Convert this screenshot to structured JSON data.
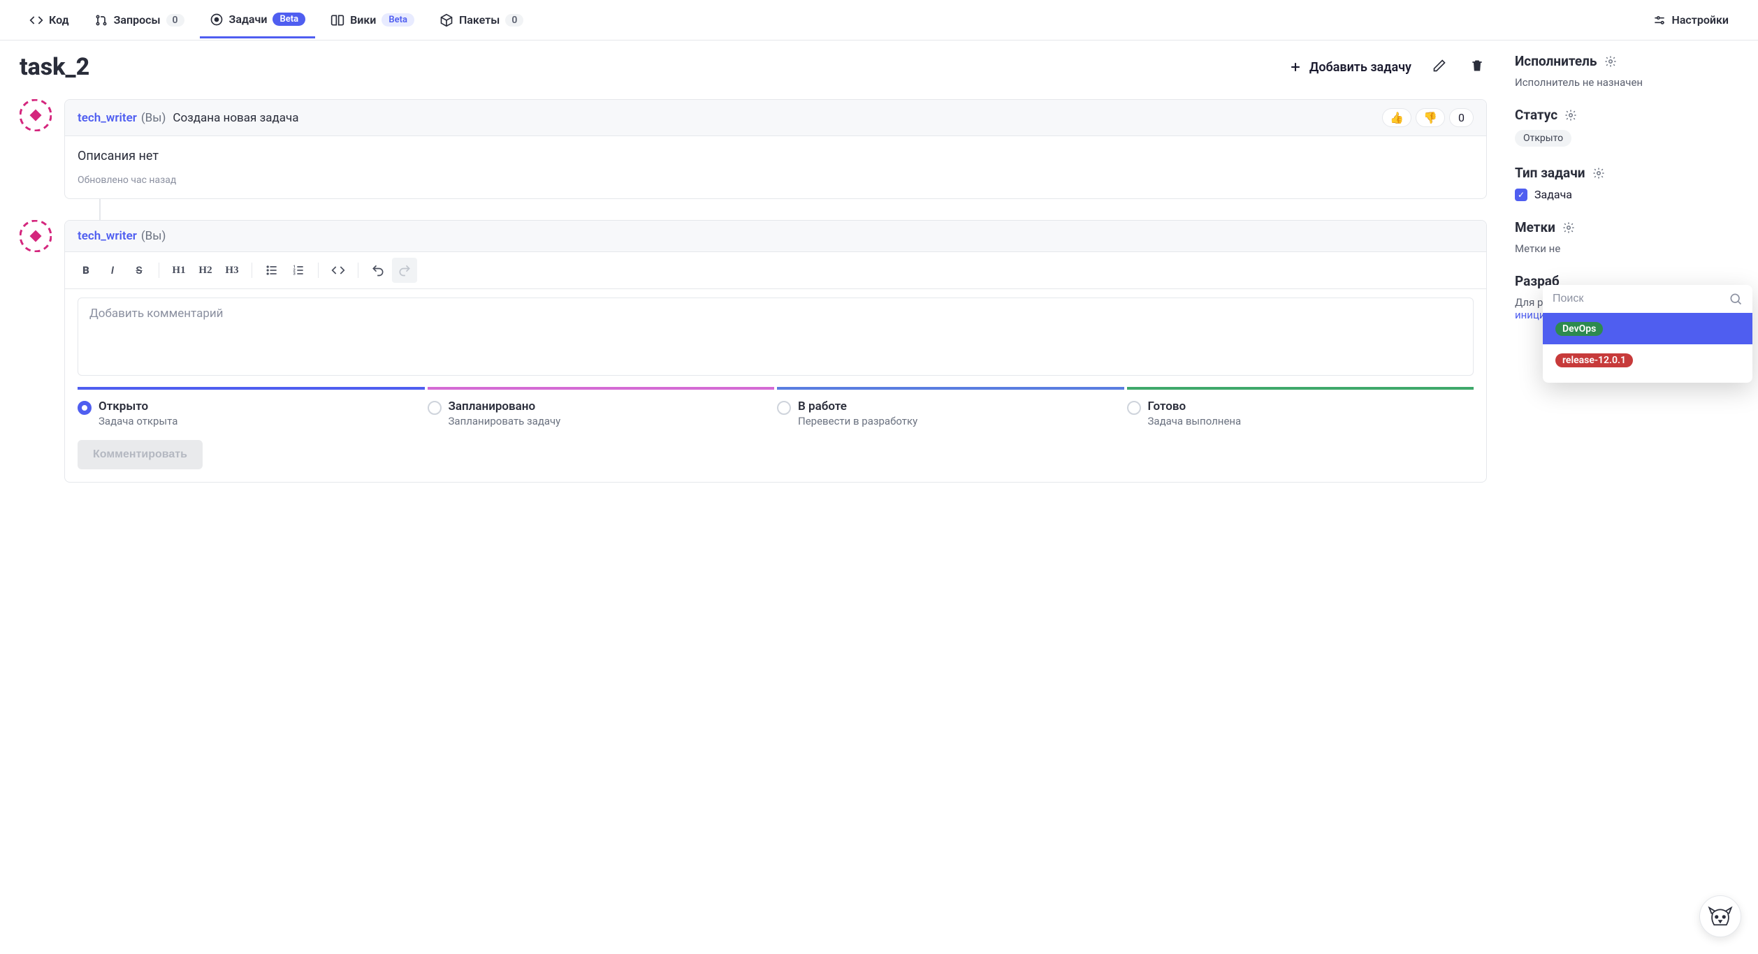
{
  "nav": {
    "code": "Код",
    "requests": "Запросы",
    "requests_count": "0",
    "tasks": "Задачи",
    "tasks_badge": "Beta",
    "wiki": "Вики",
    "wiki_badge": "Beta",
    "packages": "Пакеты",
    "packages_count": "0",
    "settings": "Настройки"
  },
  "title": "task_2",
  "actions": {
    "add_task": "Добавить задачу"
  },
  "post1": {
    "author": "tech_writer",
    "you": "(Вы)",
    "headline": "Создана новая задача",
    "reaction_count": "0",
    "body": "Описания нет",
    "updated": "Обновлено час назад"
  },
  "post2": {
    "author": "tech_writer",
    "you": "(Вы)"
  },
  "editor": {
    "placeholder": "Добавить комментарий",
    "h1": "H1",
    "h2": "H2",
    "h3": "H3"
  },
  "statuses": [
    {
      "label": "Открыто",
      "sub": "Задача открыта",
      "color": "#4f5ef0",
      "checked": true
    },
    {
      "label": "Запланировано",
      "sub": "Запланировать задачу",
      "color": "#d46bd4",
      "checked": false
    },
    {
      "label": "В работе",
      "sub": "Перевести в разработку",
      "color": "#5a7de0",
      "checked": false
    },
    {
      "label": "Готово",
      "sub": "Задача выполнена",
      "color": "#3fa86b",
      "checked": false
    }
  ],
  "submit": "Комментировать",
  "sidebar": {
    "assignee_title": "Исполнитель",
    "assignee_text": "Исполнитель не назначен",
    "status_title": "Статус",
    "status_value": "Открыто",
    "type_title": "Тип задачи",
    "type_value": "Задача",
    "labels_title": "Метки",
    "labels_text": "Метки не",
    "dev_title": "Разраб",
    "dev_text1": "Для работ",
    "dev_text2": "инициализ"
  },
  "dropdown": {
    "search_placeholder": "Поиск",
    "items": [
      {
        "label": "DevOps",
        "color": "green",
        "highlight": true
      },
      {
        "label": "release-12.0.1",
        "color": "red",
        "highlight": false
      }
    ]
  }
}
